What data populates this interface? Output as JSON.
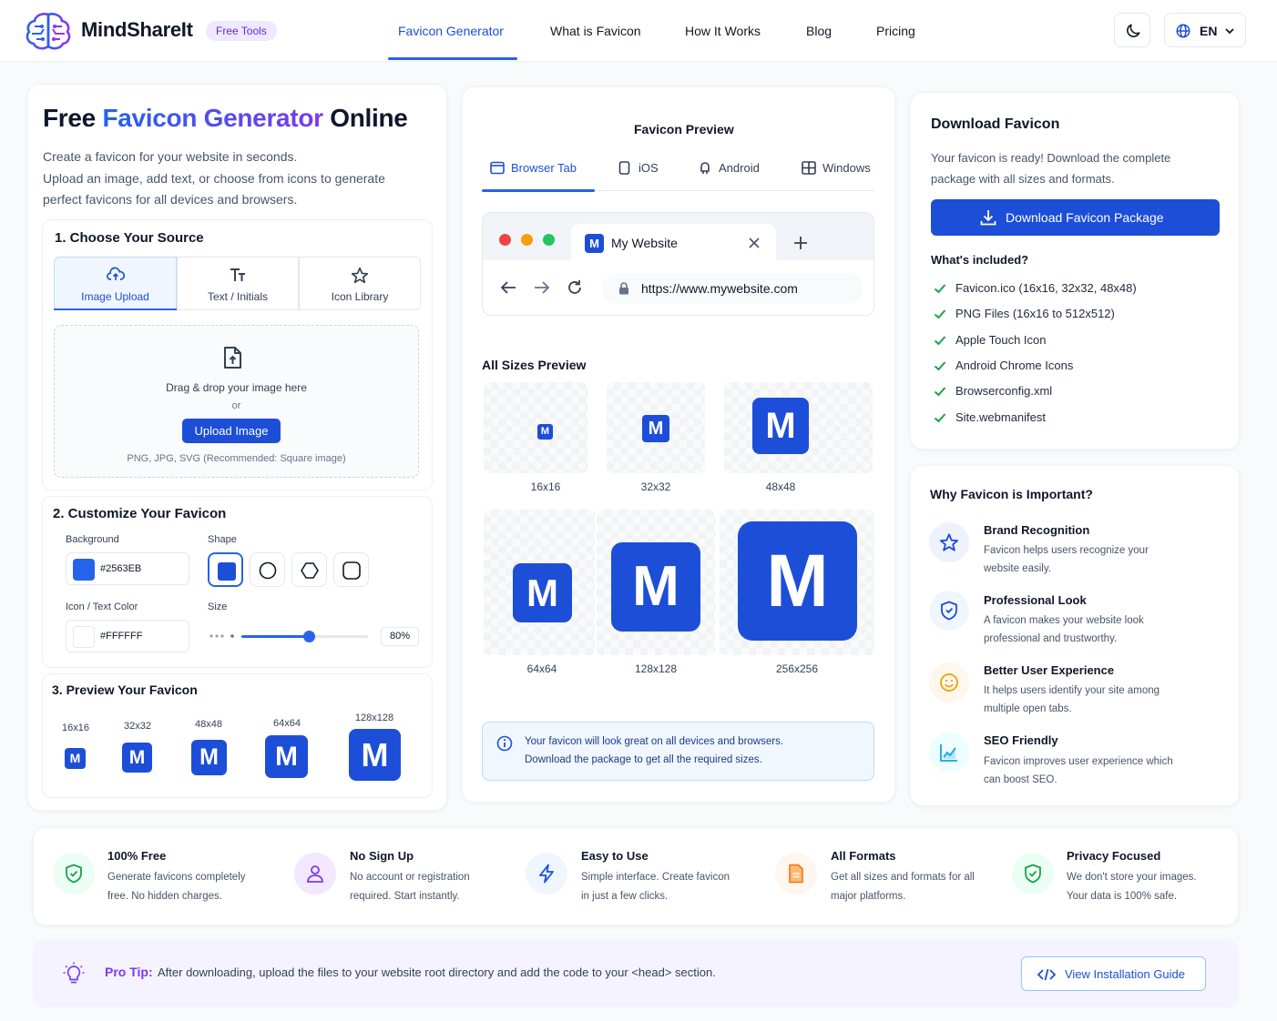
{
  "header": {
    "brand": "MindShareIt",
    "badge": "Free Tools",
    "nav": [
      "Favicon Generator",
      "What is Favicon",
      "How It Works",
      "Blog",
      "Pricing"
    ],
    "lang": "EN"
  },
  "left": {
    "title_pre": "Free ",
    "title_highlight": "Favicon Generator",
    "title_post": " Online",
    "intro": [
      "Create a favicon for your website in seconds.",
      "Upload an image, add text, or choose from icons to generate",
      "perfect favicons for all devices and browsers."
    ],
    "step1": {
      "title": "1. Choose Your Source",
      "tabs": [
        "Image Upload",
        "Text / Initials",
        "Icon Library"
      ],
      "drop_text": "Drag & drop your image here",
      "or": "or",
      "upload_button": "Upload Image",
      "formats": "PNG, JPG, SVG (Recommended: Square image)"
    },
    "step2": {
      "title": "2. Customize Your Favicon",
      "background_label": "Background",
      "background_value": "#2563EB",
      "shape_label": "Shape",
      "icon_color_label": "Icon / Text Color",
      "icon_color_value": "#FFFFFF",
      "size_label": "Size",
      "size_value": "80%",
      "size_fraction": 0.53
    },
    "step3": {
      "title": "3. Preview Your Favicon",
      "sizes": [
        "16x16",
        "32x32",
        "48x48",
        "64x64",
        "128x128"
      ],
      "letter": "M"
    }
  },
  "middle": {
    "title": "Favicon Preview",
    "tabs": [
      "Browser Tab",
      "iOS",
      "Android",
      "Windows"
    ],
    "browser": {
      "tab_title": "My Website",
      "url": "https://www.mywebsite.com",
      "favicon_letter": "M"
    },
    "all_sizes_title": "All Sizes Preview",
    "sizes": [
      "16x16",
      "32x32",
      "48x48",
      "64x64",
      "128x128",
      "256x256"
    ],
    "letter": "M",
    "info_lines": [
      "Your favicon will look great on all devices and browsers.",
      "Download the package to get all the required sizes."
    ]
  },
  "right": {
    "download": {
      "title": "Download Favicon",
      "desc": [
        "Your favicon is ready! Download the complete",
        "package with all sizes and formats."
      ],
      "button": "Download Favicon Package",
      "included_title": "What's included?",
      "items": [
        "Favicon.ico (16x16, 32x32, 48x48)",
        "PNG Files (16x16 to 512x512)",
        "Apple Touch Icon",
        "Android Chrome Icons",
        "Browserconfig.xml",
        "Site.webmanifest"
      ]
    },
    "why": {
      "title": "Why Favicon is Important?",
      "items": [
        {
          "title": "Brand Recognition",
          "desc": [
            "Favicon helps users recognize your",
            "website easily."
          ]
        },
        {
          "title": "Professional Look",
          "desc": [
            "A favicon makes your website look",
            "professional and trustworthy."
          ]
        },
        {
          "title": "Better User Experience",
          "desc": [
            "It helps users identify your site among",
            "multiple open tabs."
          ]
        },
        {
          "title": "SEO Friendly",
          "desc": [
            "Favicon improves user experience which",
            "can boost SEO."
          ]
        }
      ]
    }
  },
  "features": [
    {
      "title": "100% Free",
      "desc": [
        "Generate favicons completely",
        "free. No hidden charges."
      ]
    },
    {
      "title": "No Sign Up",
      "desc": [
        "No account or registration",
        "required. Start instantly."
      ]
    },
    {
      "title": "Easy to Use",
      "desc": [
        "Simple interface. Create favicon",
        "in just a few clicks."
      ]
    },
    {
      "title": "All Formats",
      "desc": [
        "Get all sizes and formats for all",
        "major platforms."
      ]
    },
    {
      "title": "Privacy Focused",
      "desc": [
        "We don't store your images.",
        "Your data is 100% safe."
      ]
    }
  ],
  "tip": {
    "label": "Pro Tip:",
    "text": "After downloading, upload the files to your website root directory and add the code to your <head> section.",
    "button": "View Installation Guide"
  },
  "colors": {
    "primary": "#1d4ed8",
    "accent_purple": "#7c3aed",
    "success": "#16a34a"
  }
}
